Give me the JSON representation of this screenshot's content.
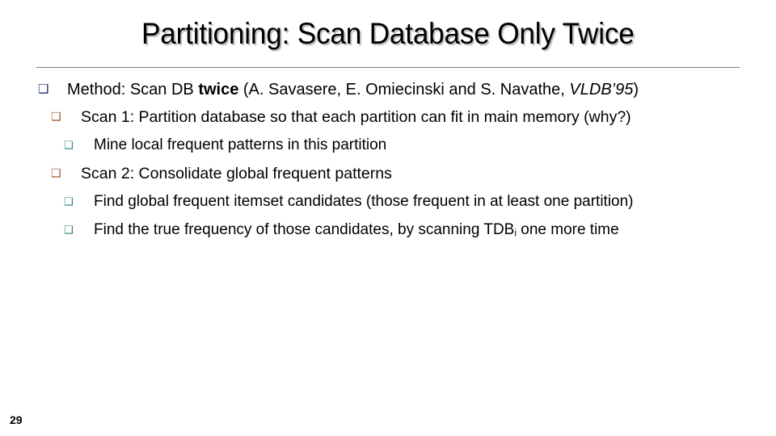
{
  "slide": {
    "title": "Partitioning: Scan Database Only Twice",
    "page_number": "29",
    "divider_color": "#7f7f7f",
    "background_color": "#ffffff"
  },
  "bullet_glyph": "❑",
  "bullet_colors": {
    "level1": "#1f2a6e",
    "level2": "#9a5430",
    "level3": "#2b7a78"
  },
  "body": {
    "lines": [
      {
        "level": 1,
        "full_text": "Method: Scan DB twice (A. Savasere, E. Omiecinski and S. Navathe, VLDB’95)",
        "part_plain_1": "Method: Scan DB ",
        "part_bold": "twice",
        "part_plain_2": " (A. Savasere, E. Omiecinski and S. Navathe, ",
        "part_italic": "VLDB’95",
        "part_plain_3": ")"
      },
      {
        "level": 2,
        "full_text": "Scan 1: Partition database so that each partition can fit in main memory (why?)"
      },
      {
        "level": 3,
        "full_text": "Mine local frequent patterns in this partition"
      },
      {
        "level": 2,
        "full_text": "Scan 2: Consolidate global frequent patterns"
      },
      {
        "level": 3,
        "full_text": "Find global frequent itemset candidates (those frequent in at least one partition)"
      },
      {
        "level": 3,
        "full_text": "Find the true frequency of those candidates, by scanning TDBi one more time",
        "part_plain_1": "Find the true frequency of those candidates, by scanning TDB",
        "part_sub": "i",
        "part_plain_2": " one more time"
      }
    ]
  }
}
